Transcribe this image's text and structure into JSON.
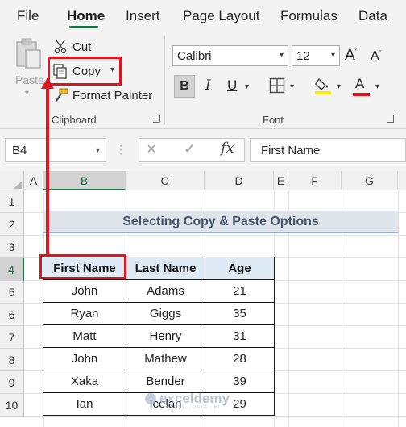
{
  "menu": {
    "tabs": [
      {
        "label": "File"
      },
      {
        "label": "Home"
      },
      {
        "label": "Insert"
      },
      {
        "label": "Page Layout"
      },
      {
        "label": "Formulas"
      },
      {
        "label": "Data"
      }
    ],
    "active_tab": "Home"
  },
  "ribbon": {
    "clipboard": {
      "paste_label": "Paste",
      "cut_label": "Cut",
      "copy_label": "Copy",
      "format_painter_label": "Format Painter",
      "group_label": "Clipboard"
    },
    "font": {
      "font_name": "Calibri",
      "font_size": "12",
      "grow_label": "A",
      "shrink_label": "A",
      "bold_label": "B",
      "italic_label": "I",
      "underline_label": "U",
      "font_color_label": "A",
      "group_label": "Font"
    },
    "colors": {
      "accent": "#1e7145",
      "highlight": "#ffeb00",
      "font_color": "#e0141e",
      "annotation": "#e0141e"
    }
  },
  "formula_bar": {
    "name_box": "B4",
    "cancel_icon": "×",
    "enter_icon": "✓",
    "fx_label": "fx",
    "content": "First Name"
  },
  "grid": {
    "columns": [
      "A",
      "B",
      "C",
      "D",
      "E",
      "F",
      "G"
    ],
    "selected_column": "B",
    "rows": [
      "1",
      "2",
      "3",
      "4",
      "5",
      "6",
      "7",
      "8",
      "9",
      "10"
    ],
    "selected_row": "4",
    "title": "Selecting Copy & Paste Options",
    "table": {
      "headers": [
        "First Name",
        "Last Name",
        "Age"
      ],
      "rows": [
        [
          "John",
          "Adams",
          "21"
        ],
        [
          "Ryan",
          "Giggs",
          "35"
        ],
        [
          "Matt",
          "Henry",
          "31"
        ],
        [
          "John",
          "Mathew",
          "28"
        ],
        [
          "Xaka",
          "Bender",
          "39"
        ],
        [
          "Ian",
          "Icelan",
          "29"
        ]
      ]
    }
  },
  "watermark": {
    "brand": "exceldemy",
    "tagline": "EXCEL · DATA · BI"
  }
}
